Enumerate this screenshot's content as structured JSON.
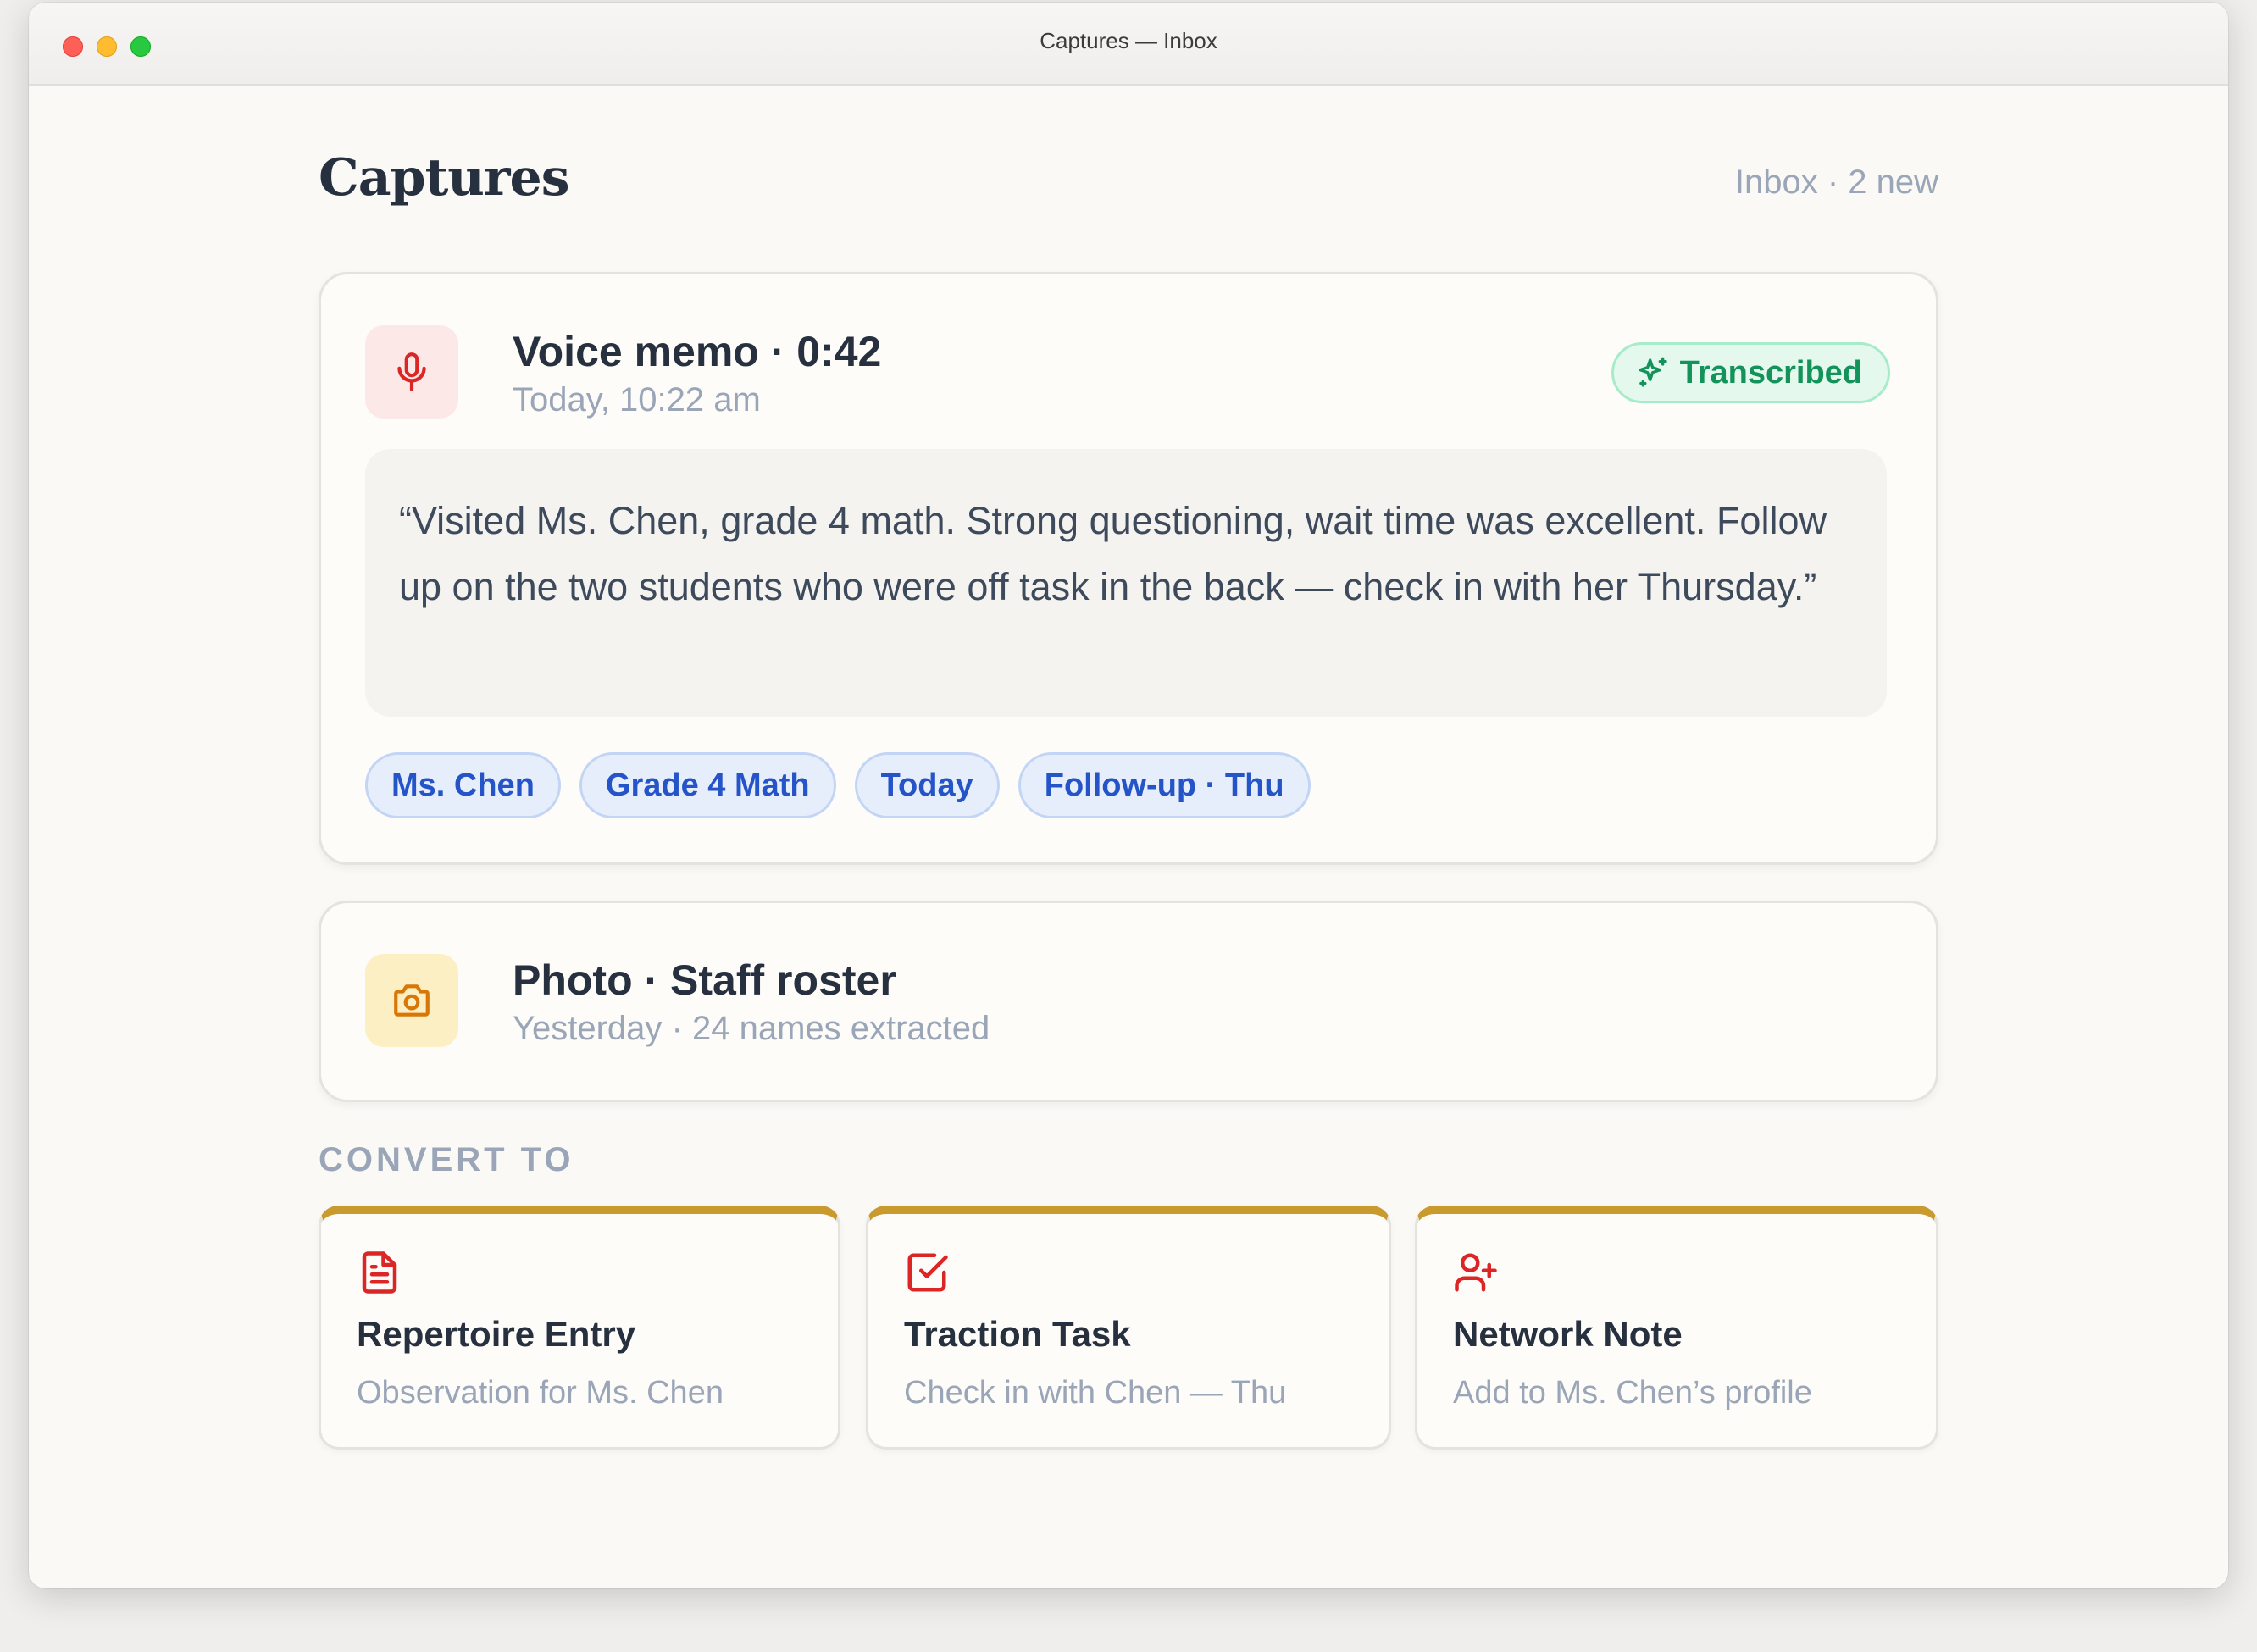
{
  "window": {
    "title": "Captures — Inbox"
  },
  "header": {
    "title": "Captures",
    "status": "Inbox · 2 new"
  },
  "voice_memo": {
    "icon": "microphone-icon",
    "title": "Voice memo · 0:42",
    "timestamp": "Today, 10:22 am",
    "badge": {
      "icon": "sparkle-icon",
      "label": "Transcribed"
    },
    "transcript": "“Visited Ms. Chen, grade 4 math. Strong questioning, wait time was excellent. Follow up on the two students who were off task in the back — check in with her Thursday.”",
    "tags": [
      "Ms. Chen",
      "Grade 4 Math",
      "Today",
      "Follow-up · Thu"
    ]
  },
  "photo": {
    "icon": "camera-icon",
    "title": "Photo · Staff roster",
    "subtitle": "Yesterday · 24 names extracted"
  },
  "convert": {
    "label": "CONVERT TO",
    "options": [
      {
        "icon": "document-icon",
        "title": "Repertoire Entry",
        "subtitle": "Observation for Ms. Chen"
      },
      {
        "icon": "checkbox-icon",
        "title": "Traction Task",
        "subtitle": "Check in with Chen — Thu"
      },
      {
        "icon": "user-plus-icon",
        "title": "Network Note",
        "subtitle": "Add to Ms. Chen’s profile"
      }
    ]
  },
  "colors": {
    "accent_red": "#dc2626",
    "accent_amber": "#d97706",
    "success_green": "#13935a",
    "tag_blue": "#2454c8",
    "gold_border": "#c99a2e"
  }
}
